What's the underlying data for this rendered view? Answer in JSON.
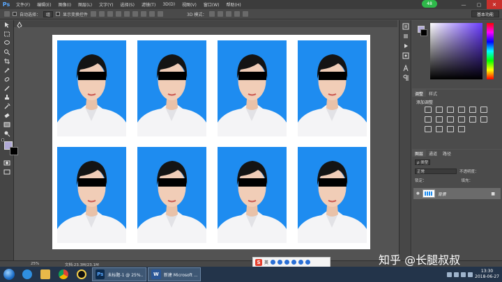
{
  "app": {
    "logo": "Ps"
  },
  "menubar": {
    "items": [
      "文件(F)",
      "编辑(E)",
      "图像(I)",
      "图层(L)",
      "文字(Y)",
      "选择(S)",
      "滤镜(T)",
      "3D(D)",
      "视图(V)",
      "窗口(W)",
      "帮助(H)"
    ],
    "badge": "48",
    "window_controls": [
      "—",
      "▢",
      "✕"
    ]
  },
  "options": {
    "auto_select_label": "自动选择：",
    "auto_select_value": "组",
    "show_transform_label": "显示变换控件",
    "mode_3d_label": "3D 模式：",
    "workspace": "基本功能"
  },
  "colors": {
    "foreground": "#b0a9d6",
    "background": "#000000",
    "photo_backdrop": "#1e8cf0"
  },
  "panels": {
    "adjust_tabs": [
      "调整",
      "样式"
    ],
    "adjust_title": "添加调整",
    "layers_tabs": [
      "图层",
      "通道",
      "路径"
    ],
    "filter_kind": "ρ 类型",
    "blend_mode": "正常",
    "opacity_label": "不透明度：",
    "lock_label": "锁定：",
    "fill_label": "填充：",
    "layer_name": "背景"
  },
  "status": {
    "zoom": "25%",
    "doc_size": "文档:23.3M/23.1M"
  },
  "ime": {
    "mode": "英"
  },
  "watermark": "知乎 @长腿叔叔",
  "taskbar": {
    "ps_task": "未标题-1 @ 25%...",
    "word_task": "新建 Microsoft ...",
    "time": "13:30",
    "date": "2018-06-27"
  },
  "photos": {
    "count": 8,
    "columns": 4,
    "rows": 2
  }
}
